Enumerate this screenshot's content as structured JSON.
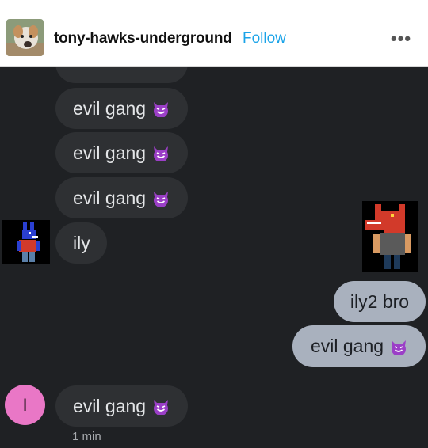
{
  "header": {
    "username": "tony-hawks-underground",
    "follow_label": "Follow",
    "more_label": "•••"
  },
  "messages": [
    {
      "text": "evil gang",
      "emoji": "smiling-imp"
    },
    {
      "text": "evil gang",
      "emoji": "smiling-imp"
    },
    {
      "text": "evil gang",
      "emoji": "smiling-imp"
    },
    {
      "text": "ily"
    },
    {
      "text": "ily2 bro"
    },
    {
      "text": "evil gang",
      "emoji": "smiling-imp"
    },
    {
      "text": "evil gang",
      "emoji": "smiling-imp"
    }
  ],
  "contact_initial": "I",
  "timestamp": "1 min",
  "colors": {
    "background": "#1f2124",
    "incoming_bubble": "#2e3033",
    "outgoing_bubble": "#a9b1be",
    "follow": "#1aa3e8",
    "contact_avatar": "#e977c6",
    "emoji": "#9b3fc7"
  }
}
